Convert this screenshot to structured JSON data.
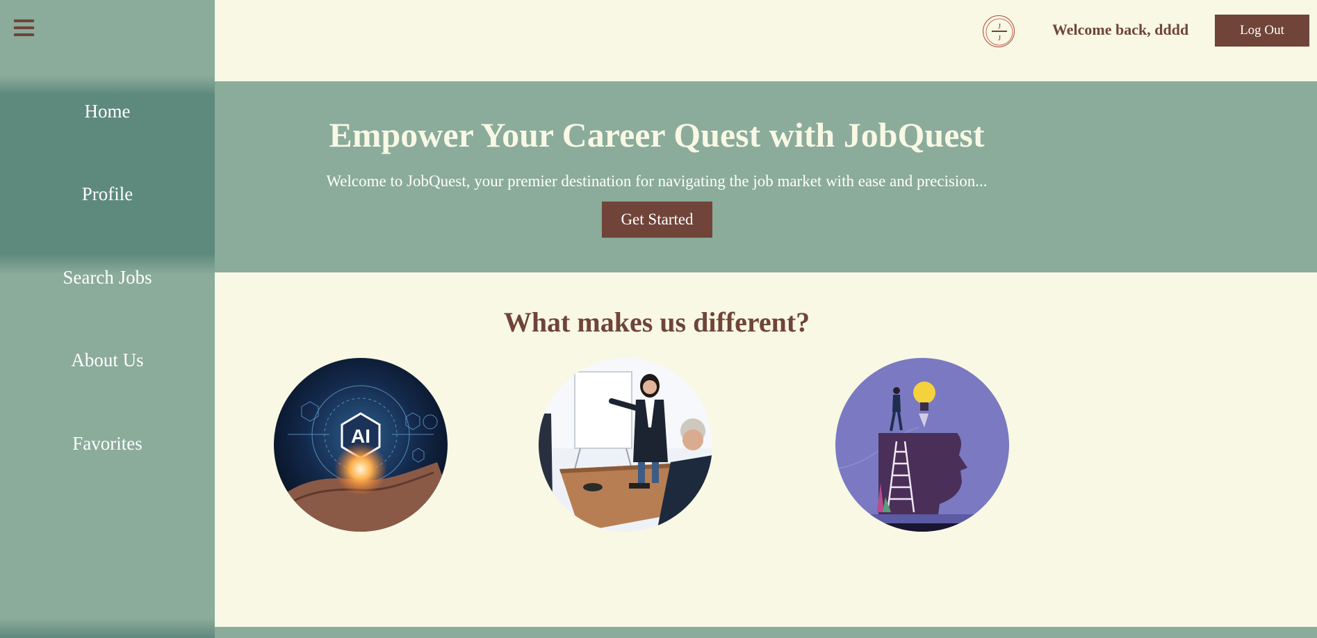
{
  "sidebar": {
    "menu_icon": "hamburger-menu-icon",
    "items": [
      {
        "label": "Home"
      },
      {
        "label": "Profile"
      },
      {
        "label": "Search Jobs"
      },
      {
        "label": "About Us"
      },
      {
        "label": "Favorites"
      }
    ]
  },
  "header": {
    "logo_icon": "jobquest-logo",
    "welcome_text": "Welcome back, dddd",
    "logout_label": "Log Out"
  },
  "hero": {
    "title": "Empower Your Career Quest with JobQuest",
    "subtitle": "Welcome to JobQuest, your premier destination for navigating the job market with ease and precision...",
    "cta_label": "Get Started"
  },
  "features": {
    "title": "What makes us different?",
    "images": [
      {
        "icon": "ai-hand-image"
      },
      {
        "icon": "business-presentation-image"
      },
      {
        "icon": "idea-head-ladder-image"
      }
    ]
  },
  "colors": {
    "sage": "#8bab9b",
    "sage_dark": "#5e897d",
    "cream": "#f8f8e4",
    "brown": "#704438",
    "white": "#ffffff"
  }
}
